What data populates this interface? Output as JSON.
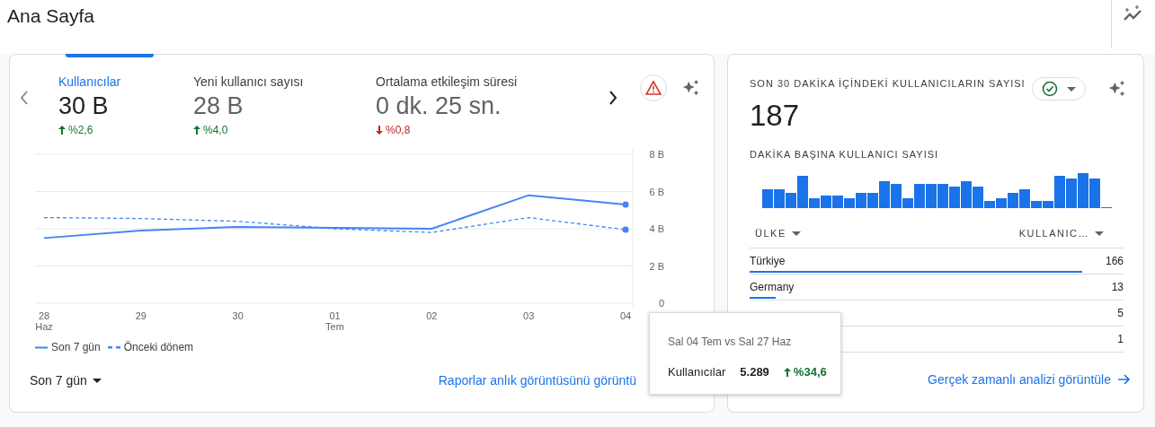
{
  "page_title": "Ana Sayfa",
  "overview": {
    "metrics": [
      {
        "label": "Kullanıcılar",
        "value": "30 B",
        "change": "%2,6",
        "kind": "up",
        "selected": true
      },
      {
        "label": "Yeni kullanıcı sayısı",
        "value": "28 B",
        "change": "%4,0",
        "kind": "up",
        "selected": false
      },
      {
        "label": "Ortalama etkileşim süresi",
        "value": "0 dk. 25 sn.",
        "change": "%0,8",
        "kind": "down",
        "selected": false
      }
    ],
    "chart_data": {
      "type": "line",
      "categories": [
        "28 Haz",
        "29",
        "30",
        "01 Tem",
        "02",
        "03",
        "04"
      ],
      "grid": true,
      "ylim": [
        0,
        8
      ],
      "yticks": [
        {
          "value": 0,
          "label": "0"
        },
        {
          "value": 2,
          "label": "2 B"
        },
        {
          "value": 4,
          "label": "4 B"
        },
        {
          "value": 6,
          "label": "6 B"
        },
        {
          "value": 8,
          "label": "8 B"
        }
      ],
      "series": [
        {
          "name": "Son 7 gün",
          "color": "#4285f4",
          "line_style": "solid",
          "values": [
            3.5,
            3.9,
            4.1,
            4.05,
            4.0,
            5.8,
            5.3
          ]
        },
        {
          "name": "Önceki dönem",
          "color": "#4285f4",
          "line_style": "dashed",
          "values": [
            4.6,
            4.55,
            4.4,
            4.0,
            3.8,
            4.6,
            3.95
          ]
        }
      ]
    },
    "period": "Son 7 gün",
    "link": "Raporlar anlık görüntüsünü görüntü"
  },
  "tooltip": {
    "title": "Sal 04 Tem vs Sal 27 Haz",
    "label": "Kullanıcılar",
    "value": "5.289",
    "change": "%34,6",
    "kind": "up"
  },
  "realtime": {
    "title": "SON 30 DAKİKA İÇİNDEKİ KULLANICILARIN SAYISI",
    "value": "187",
    "subtitle": "DAKİKA BAŞINA KULLANICI SAYISI",
    "columns": [
      "ÜLKE",
      "KULLANIC…"
    ],
    "rows": [
      {
        "country": "Türkiye",
        "users": "166",
        "level": 0.89
      },
      {
        "country": "Germany",
        "users": "13",
        "level": 0.07
      },
      {
        "users": "5"
      },
      {
        "users": "1"
      }
    ],
    "link": "Gerçek zamanlı analizi görüntüle"
  }
}
